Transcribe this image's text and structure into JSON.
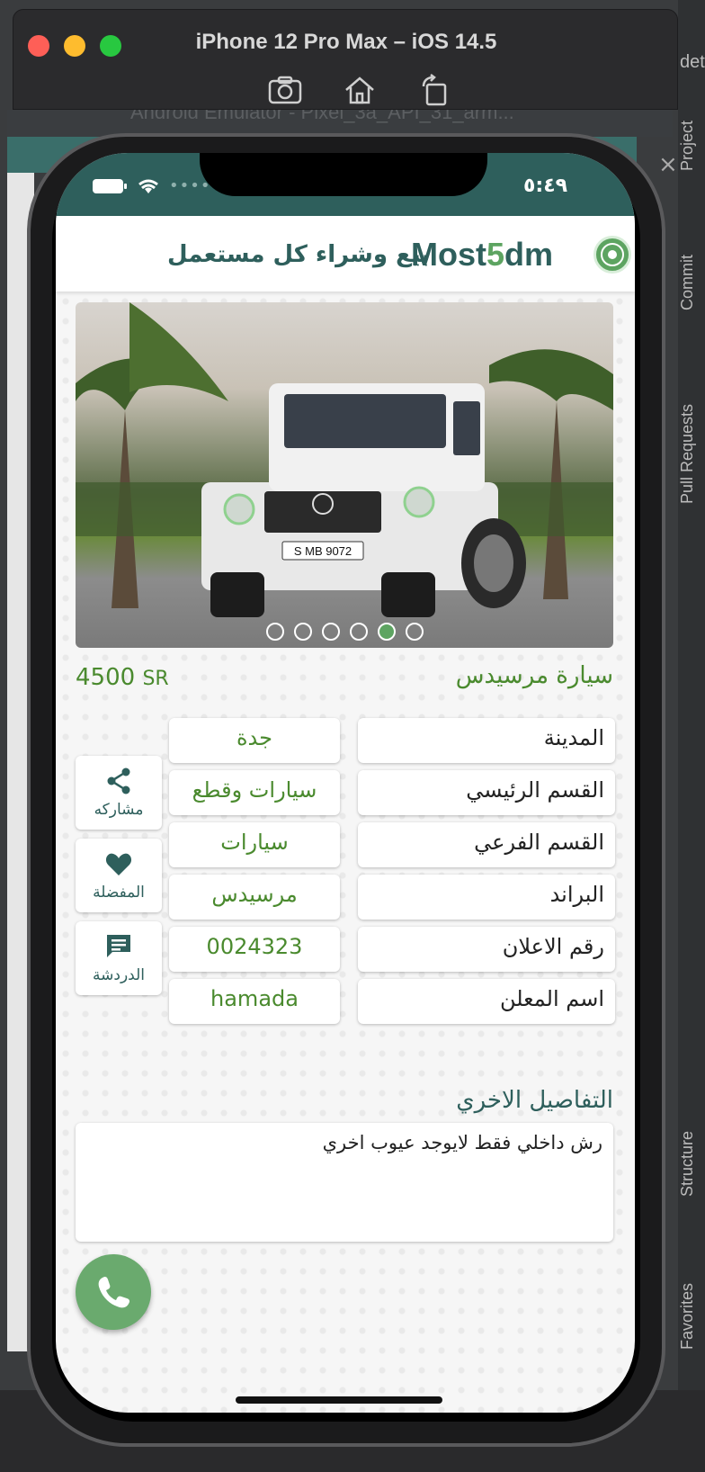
{
  "simulator": {
    "title": "iPhone 12 Pro Max – iOS 14.5",
    "behind_title": "Android Emulator - Pixel_3a_API_31_arm...",
    "ide_tabs": [
      "Project",
      "Commit",
      "Pull Requests",
      "Structure",
      "Favorites"
    ],
    "ide_fragment": "det"
  },
  "status": {
    "time": "٥:٤٩"
  },
  "header": {
    "brand_a": "Most",
    "brand_five": "5",
    "brand_b": "dm",
    "tagline": "بيع وشراء كل مستعمل"
  },
  "carousel": {
    "dot_count": 6,
    "active_index": 4,
    "plate": "S MB 9072"
  },
  "listing": {
    "title": "سيارة مرسيدس",
    "price": "4500",
    "currency": "SR"
  },
  "fields": [
    {
      "label": "المدينة",
      "value": "جدة"
    },
    {
      "label": "القسم الرئيسي",
      "value": "سيارات وقطع"
    },
    {
      "label": "القسم الفرعي",
      "value": "سيارات"
    },
    {
      "label": "البراند",
      "value": "مرسيدس"
    },
    {
      "label": "رقم الاعلان",
      "value": "0024323"
    },
    {
      "label": "اسم المعلن",
      "value": "hamada"
    }
  ],
  "actions": {
    "share": "مشاركه",
    "favorite": "المفضلة",
    "chat": "الدردشة"
  },
  "details": {
    "title": "التفاصيل الاخري",
    "text": "رش داخلي فقط لايوجد عيوب اخري"
  },
  "colors": {
    "primary": "#2e5f5c",
    "accent": "#5da461",
    "value_text": "#4a8a2e"
  }
}
